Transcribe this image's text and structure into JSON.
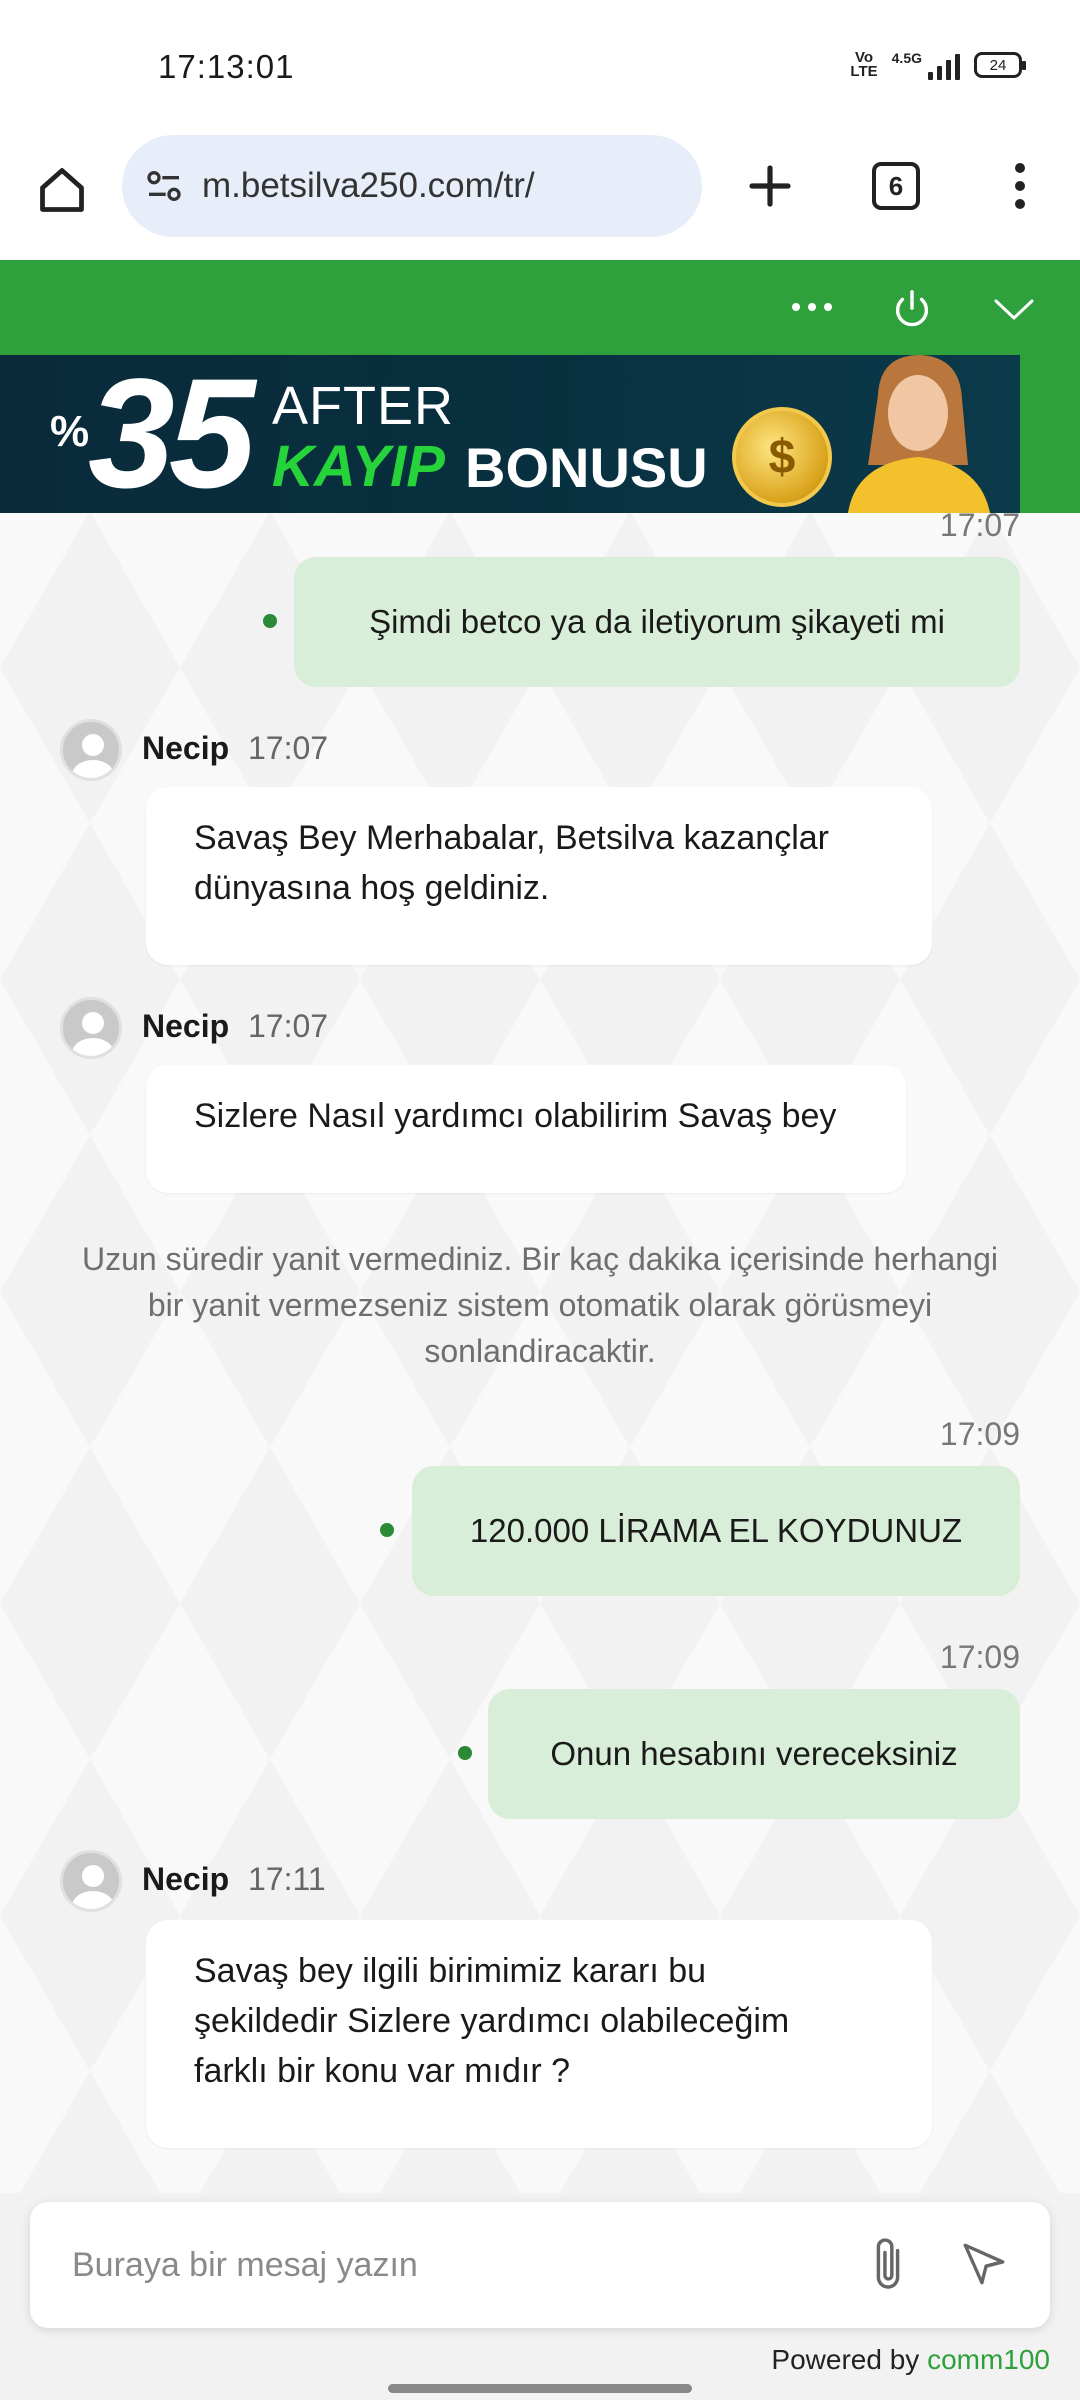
{
  "status_bar": {
    "time": "17:13:01",
    "volte_label": "Vo\nLTE",
    "network_label": "4.5G",
    "battery": "24"
  },
  "browser": {
    "url": "m.betsilva250.com/tr/",
    "tab_count": "6"
  },
  "banner": {
    "percent_sign": "%",
    "number": "35",
    "after": "AFTER",
    "kayip": "KAYIP",
    "bonus": "BONUSU",
    "coin_symbol": "$"
  },
  "chat": {
    "messages": [
      {
        "type": "outgoing",
        "time": "17:07",
        "text": "Şimdi betco ya da iletiyorum şikayeti mi"
      },
      {
        "type": "incoming",
        "agent": "Necip",
        "time": "17:07",
        "text_lines": [
          "Savaş Bey Merhabalar, Betsilva kazançlar",
          "dünyasına hoş geldiniz."
        ]
      },
      {
        "type": "incoming",
        "agent": "Necip",
        "time": "17:07",
        "text_lines": [
          "Sizlere Nasıl yardımcı olabilirim Savaş bey"
        ]
      },
      {
        "type": "system",
        "text_lines": [
          "Uzun süredir yanit vermediniz. Bir kaç dakika içerisinde herhangi",
          "bir yanit vermezseniz sistem otomatik olarak görüsmeyi",
          "sonlandiracaktir."
        ]
      },
      {
        "type": "outgoing",
        "time": "17:09",
        "text": "120.000 LİRAMA EL KOYDUNUZ"
      },
      {
        "type": "outgoing",
        "time": "17:09",
        "text": "Onun hesabını vereceksiniz"
      },
      {
        "type": "incoming",
        "agent": "Necip",
        "time": "17:11",
        "text_lines": [
          "Savaş bey ilgili birimimiz kararı bu",
          "şekildedir Sizlere yardımcı olabileceğim",
          "farklı bir konu var mıdır ?"
        ]
      }
    ]
  },
  "composer": {
    "placeholder": "Buraya bir mesaj yazın"
  },
  "footer": {
    "powered_prefix": "Powered by ",
    "powered_brand": "comm100"
  },
  "colors": {
    "header_green": "#2ea03c",
    "outgoing_bubble": "#d9eed8",
    "url_bar": "#e8eef9",
    "brand_green": "#2ea03c"
  }
}
